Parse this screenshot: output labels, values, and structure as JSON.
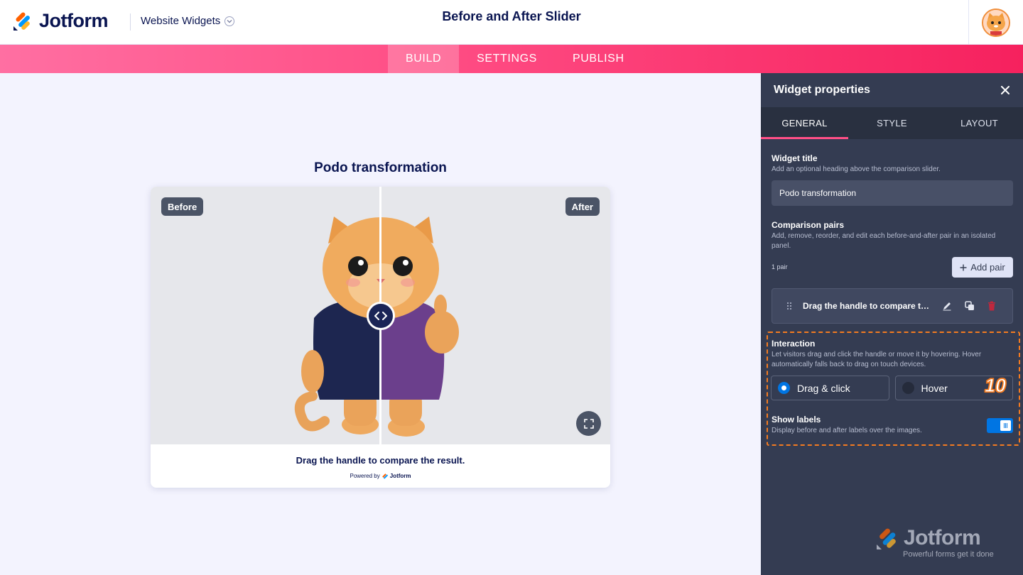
{
  "header": {
    "brand": "Jotform",
    "product_switcher": "Website Widgets",
    "page_title": "Before and After Slider"
  },
  "nav": {
    "tabs": [
      {
        "label": "BUILD",
        "active": true
      },
      {
        "label": "SETTINGS",
        "active": false
      },
      {
        "label": "PUBLISH",
        "active": false
      }
    ]
  },
  "preview": {
    "heading": "Podo transformation",
    "before_label": "Before",
    "after_label": "After",
    "caption": "Drag the handle to compare the result.",
    "powered_by": "Powered by",
    "powered_brand": "Jotform",
    "slider_position": 0.5
  },
  "panel": {
    "title": "Widget properties",
    "tabs": [
      {
        "label": "GENERAL",
        "active": true
      },
      {
        "label": "STYLE",
        "active": false
      },
      {
        "label": "LAYOUT",
        "active": false
      }
    ],
    "widget_title": {
      "label": "Widget title",
      "description": "Add an optional heading above the comparison slider.",
      "value": "Podo transformation"
    },
    "comparison_pairs": {
      "label": "Comparison pairs",
      "description": "Add, remove, reorder, and edit each before-and-after pair in an isolated panel.",
      "count": "1 pair",
      "add_button": "Add pair",
      "items": [
        {
          "label": "Drag the handle to compare the result."
        }
      ]
    },
    "interaction": {
      "label": "Interaction",
      "description": "Let visitors drag and click the handle or move it by hovering. Hover automatically falls back to drag on touch devices.",
      "options": [
        {
          "label": "Drag & click",
          "selected": true
        },
        {
          "label": "Hover",
          "selected": false
        }
      ]
    },
    "show_labels": {
      "label": "Show labels",
      "description": "Display before and after labels over the images.",
      "enabled": true
    },
    "step_marker": "10",
    "watermark": {
      "brand": "Jotform",
      "tagline": "Powerful forms get it done"
    }
  },
  "colors": {
    "accent_pink": "#ff4f86",
    "navy": "#0a1551",
    "panel_bg": "#343c52",
    "toggle_blue": "#0075e3",
    "highlight_orange": "#f47b20"
  }
}
